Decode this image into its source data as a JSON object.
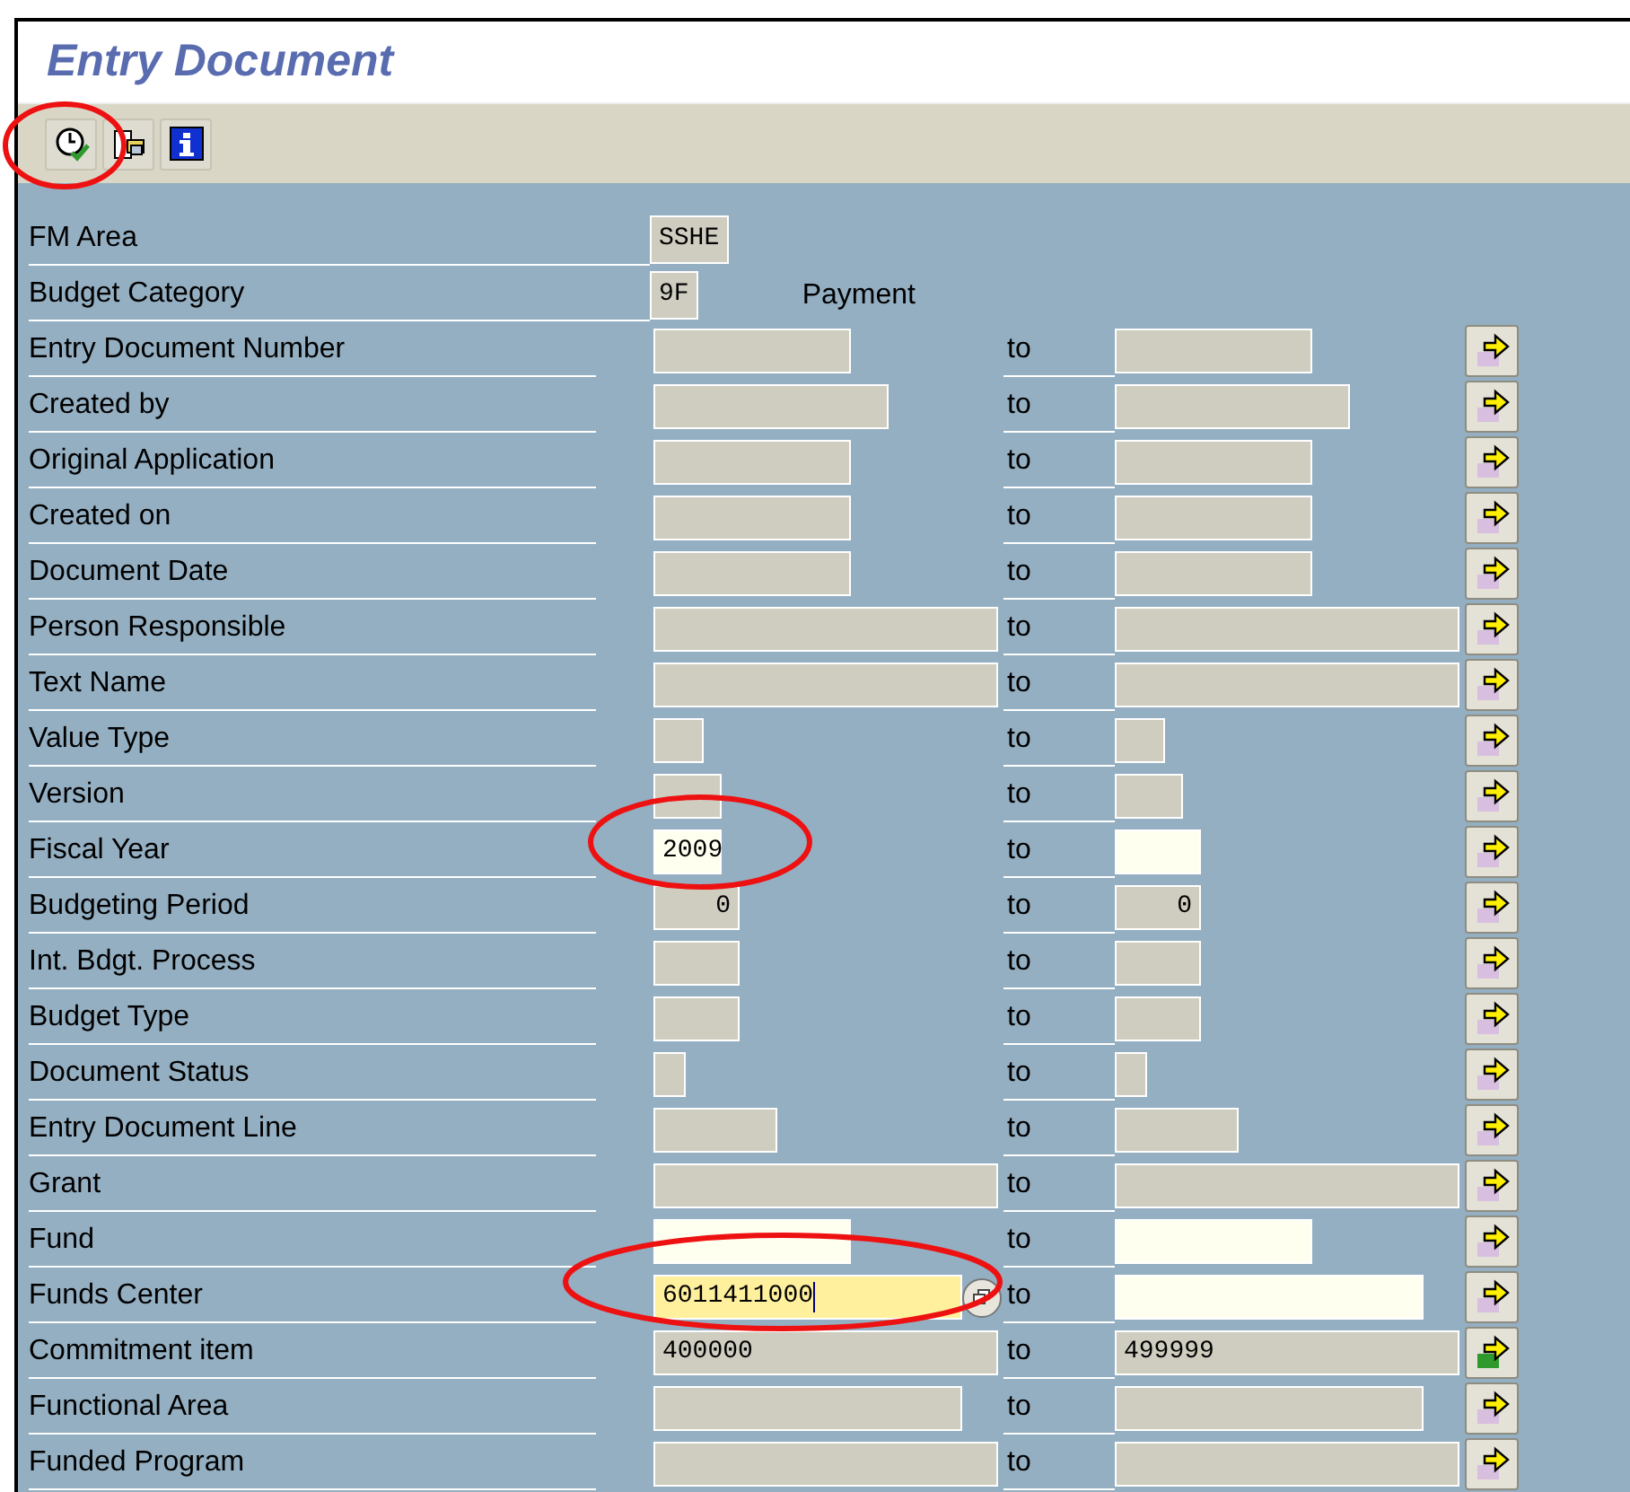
{
  "window": {
    "title": "Entry Document"
  },
  "toolbar": [
    {
      "kind": "execute"
    },
    {
      "kind": "variants"
    },
    {
      "kind": "info"
    }
  ],
  "rows": [
    {
      "kind": "single",
      "label": "FM Area",
      "value": "SSHE"
    },
    {
      "kind": "single",
      "label": "Budget Category",
      "value": "9F",
      "description": "Payment"
    },
    {
      "kind": "range",
      "label": "Entry Document Number",
      "low": {
        "kind": "disabled"
      },
      "to": "to",
      "high": {
        "kind": "disabled"
      },
      "has_entries": false
    },
    {
      "kind": "range",
      "label": "Created by",
      "low": {
        "kind": "disabled"
      },
      "to": "to",
      "high": {
        "kind": "disabled"
      },
      "has_entries": false
    },
    {
      "kind": "range",
      "label": "Original Application",
      "low": {
        "kind": "disabled"
      },
      "to": "to",
      "high": {
        "kind": "disabled"
      },
      "has_entries": false
    },
    {
      "kind": "range",
      "label": "Created on",
      "low": {
        "kind": "disabled"
      },
      "to": "to",
      "high": {
        "kind": "disabled"
      },
      "has_entries": false
    },
    {
      "kind": "range",
      "label": "Document Date",
      "low": {
        "kind": "disabled"
      },
      "to": "to",
      "high": {
        "kind": "disabled"
      },
      "has_entries": false
    },
    {
      "kind": "range",
      "label": "Person Responsible",
      "low": {
        "kind": "disabled"
      },
      "to": "to",
      "high": {
        "kind": "disabled"
      },
      "has_entries": false
    },
    {
      "kind": "range",
      "label": "Text Name",
      "low": {
        "kind": "disabled"
      },
      "to": "to",
      "high": {
        "kind": "disabled"
      },
      "has_entries": false
    },
    {
      "kind": "range",
      "label": "Value Type",
      "low": {
        "kind": "disabled"
      },
      "to": "to",
      "high": {
        "kind": "disabled"
      },
      "has_entries": false
    },
    {
      "kind": "range",
      "label": "Version",
      "low": {
        "kind": "disabled"
      },
      "to": "to",
      "high": {
        "kind": "disabled"
      },
      "has_entries": false
    },
    {
      "kind": "range",
      "label": "Fiscal Year",
      "low": {
        "kind": "input",
        "value": "2009"
      },
      "to": "to",
      "high": {
        "kind": "input"
      },
      "has_entries": false
    },
    {
      "kind": "range",
      "label": "Budgeting Period",
      "low": {
        "kind": "disabled",
        "value": "0"
      },
      "to": "to",
      "high": {
        "kind": "disabled",
        "value": "0"
      },
      "has_entries": false
    },
    {
      "kind": "range",
      "label": "Int. Bdgt. Process",
      "low": {
        "kind": "disabled"
      },
      "to": "to",
      "high": {
        "kind": "disabled"
      },
      "has_entries": false
    },
    {
      "kind": "range",
      "label": "Budget Type",
      "low": {
        "kind": "disabled"
      },
      "to": "to",
      "high": {
        "kind": "disabled"
      },
      "has_entries": false
    },
    {
      "kind": "range",
      "label": "Document Status",
      "low": {
        "kind": "disabled"
      },
      "to": "to",
      "high": {
        "kind": "disabled"
      },
      "has_entries": false
    },
    {
      "kind": "range",
      "label": "Entry Document Line",
      "low": {
        "kind": "disabled"
      },
      "to": "to",
      "high": {
        "kind": "disabled"
      },
      "has_entries": false
    },
    {
      "kind": "range",
      "label": "Grant",
      "low": {
        "kind": "disabled"
      },
      "to": "to",
      "high": {
        "kind": "disabled"
      },
      "has_entries": false
    },
    {
      "kind": "range",
      "label": "Fund",
      "low": {
        "kind": "input"
      },
      "to": "to",
      "high": {
        "kind": "input"
      },
      "has_entries": false
    },
    {
      "kind": "range",
      "label": "Funds Center",
      "low": {
        "kind": "focused",
        "value": "6011411000",
        "help": true
      },
      "to": "to",
      "high": {
        "kind": "input"
      },
      "has_entries": false
    },
    {
      "kind": "range",
      "label": "Commitment item",
      "low": {
        "kind": "disabled",
        "value": "400000"
      },
      "to": "to",
      "high": {
        "kind": "disabled",
        "value": "499999"
      },
      "has_entries": true
    },
    {
      "kind": "range",
      "label": "Functional Area",
      "low": {
        "kind": "disabled"
      },
      "to": "to",
      "high": {
        "kind": "disabled"
      },
      "has_entries": false
    },
    {
      "kind": "range",
      "label": "Funded Program",
      "low": {
        "kind": "disabled"
      },
      "to": "to",
      "high": {
        "kind": "disabled"
      },
      "has_entries": false
    }
  ]
}
